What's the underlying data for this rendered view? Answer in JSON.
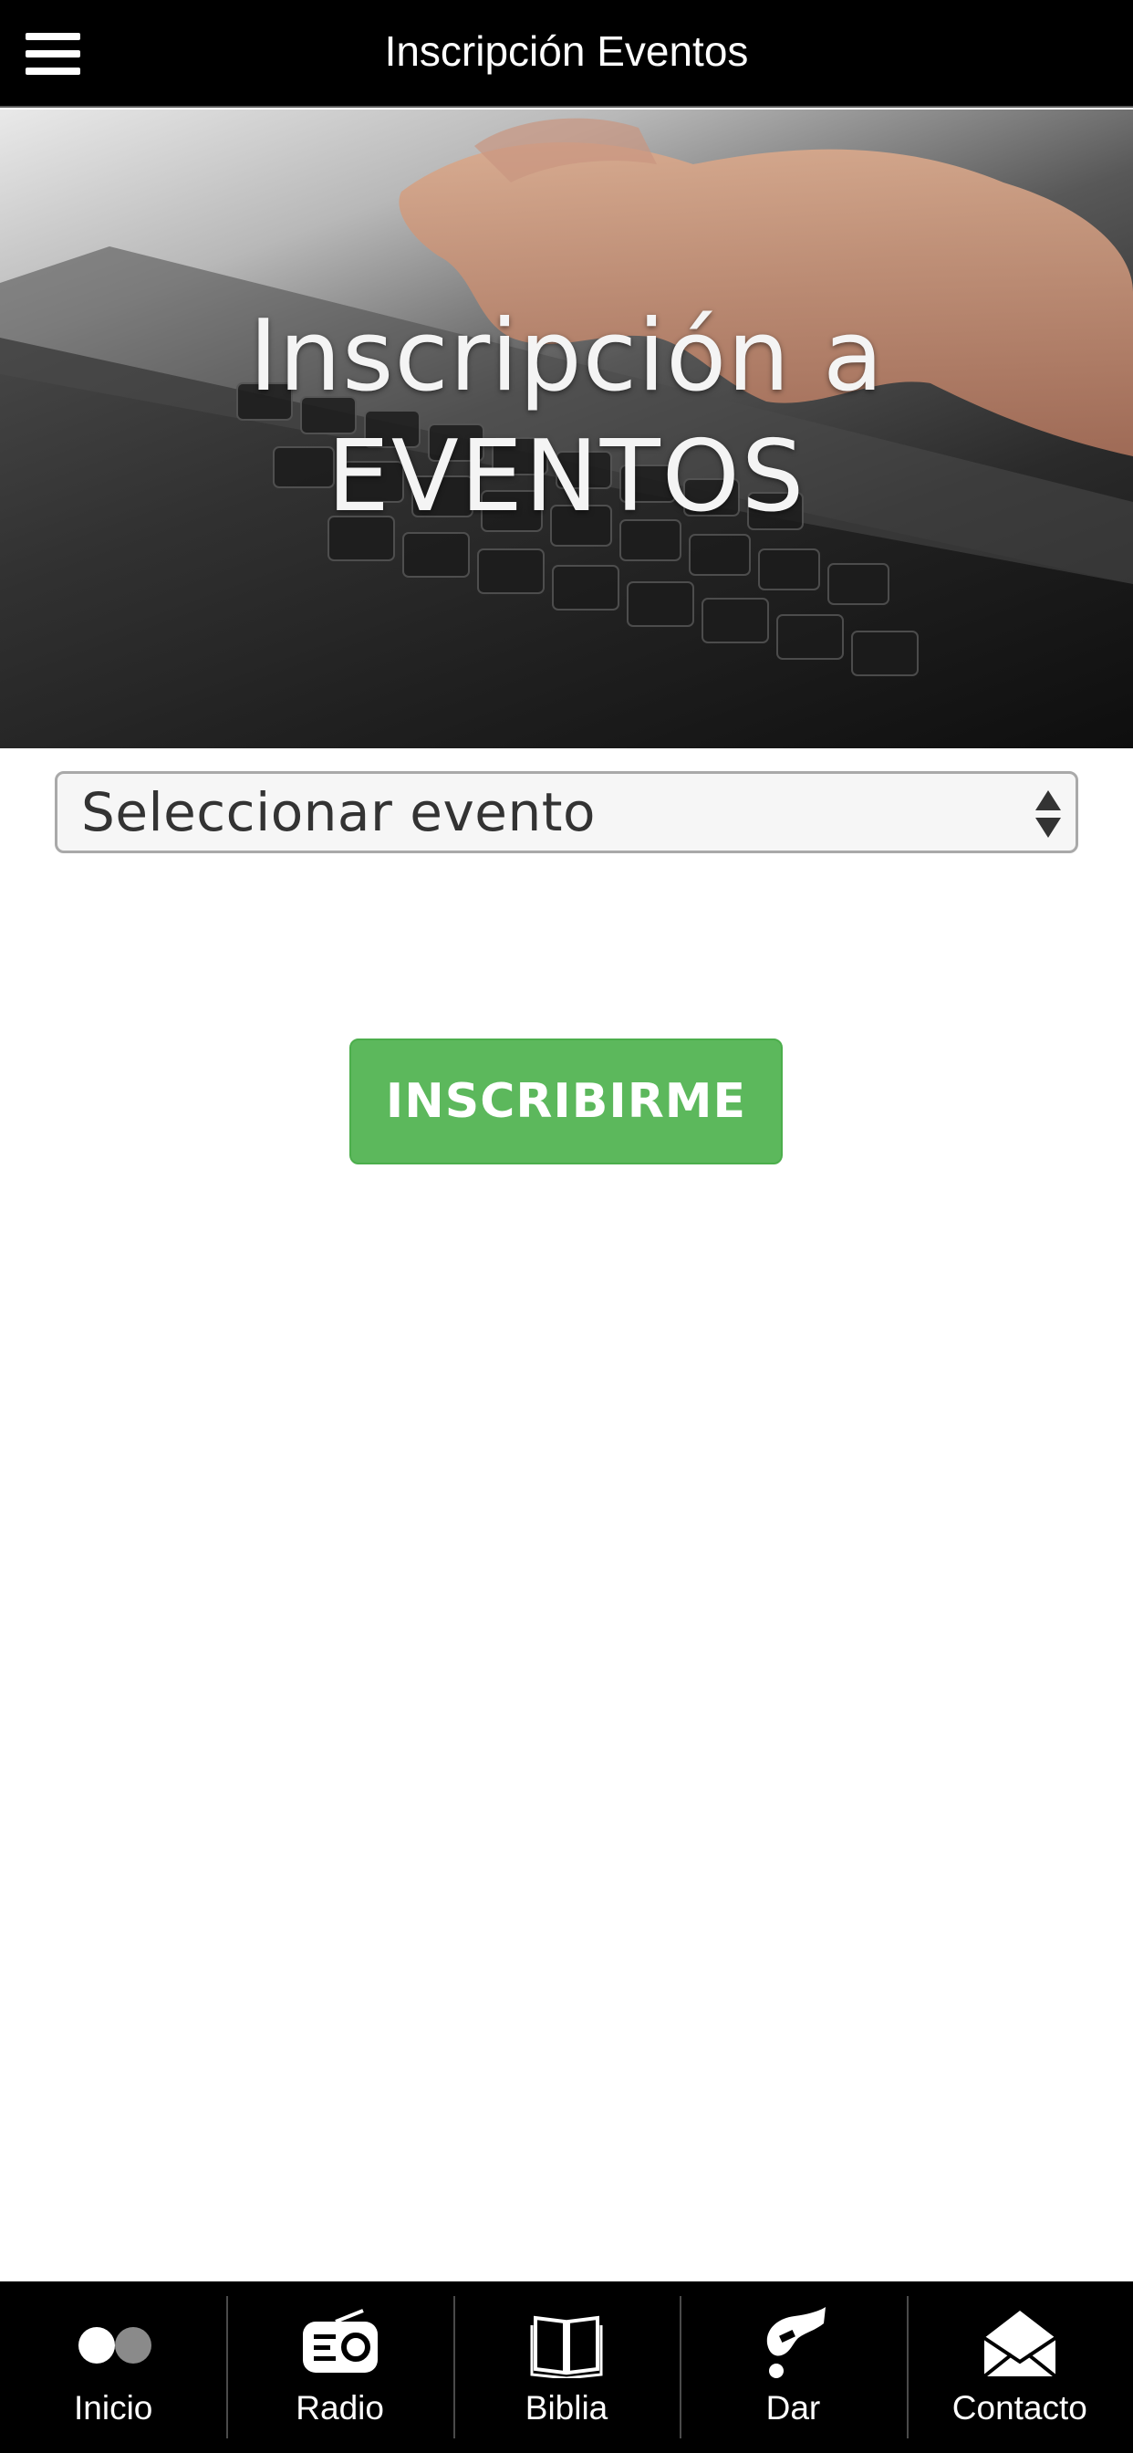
{
  "header": {
    "title": "Inscripción Eventos",
    "menu_icon": "hamburger-menu-icon"
  },
  "banner": {
    "line1": "Inscripción a",
    "line2": "EVENTOS"
  },
  "form": {
    "event_select_value": "Seleccionar evento",
    "submit_label": "INSCRIBIRME"
  },
  "tabbar": {
    "items": [
      {
        "label": "Inicio",
        "icon": "dots-icon"
      },
      {
        "label": "Radio",
        "icon": "radio-icon"
      },
      {
        "label": "Biblia",
        "icon": "book-icon"
      },
      {
        "label": "Dar",
        "icon": "give-icon"
      },
      {
        "label": "Contacto",
        "icon": "envelope-icon"
      }
    ]
  },
  "colors": {
    "header_bg": "#000000",
    "button_green": "#5cb85c",
    "tabbar_bg": "#000000"
  }
}
